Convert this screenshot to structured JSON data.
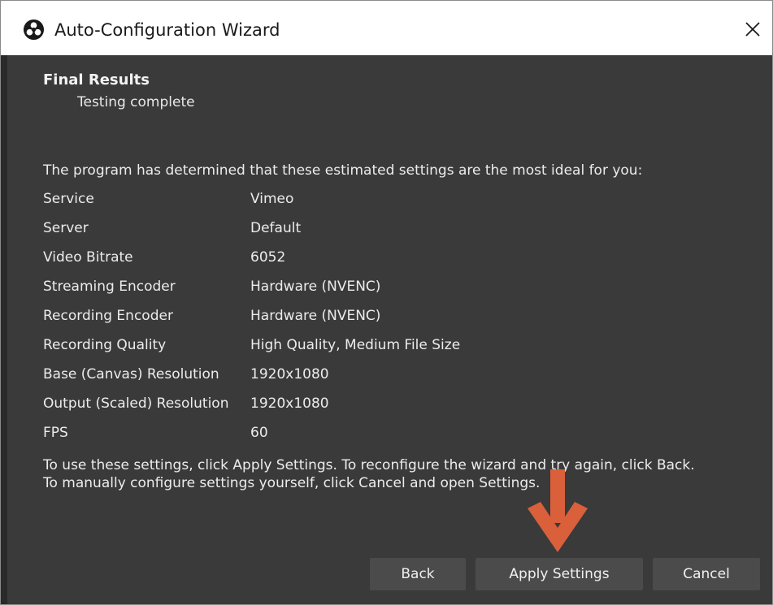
{
  "window": {
    "title": "Auto-Configuration Wizard",
    "close_label": "✕",
    "app_icon": "obs-logo-icon"
  },
  "header": {
    "title": "Final Results",
    "subtitle": "Testing complete"
  },
  "intro": "The program has determined that these estimated settings are the most ideal for you:",
  "settings": [
    {
      "label": "Service",
      "value": "Vimeo"
    },
    {
      "label": "Server",
      "value": "Default"
    },
    {
      "label": "Video Bitrate",
      "value": "6052"
    },
    {
      "label": "Streaming Encoder",
      "value": "Hardware (NVENC)"
    },
    {
      "label": "Recording Encoder",
      "value": "Hardware (NVENC)"
    },
    {
      "label": "Recording Quality",
      "value": "High Quality, Medium File Size"
    },
    {
      "label": "Base (Canvas) Resolution",
      "value": "1920x1080"
    },
    {
      "label": "Output (Scaled) Resolution",
      "value": "1920x1080"
    },
    {
      "label": "FPS",
      "value": "60"
    }
  ],
  "footer": {
    "line1": "To use these settings, click Apply Settings. To reconfigure the wizard and try again, click Back.",
    "line2": "To manually configure settings yourself, click Cancel and open Settings."
  },
  "buttons": {
    "back": "Back",
    "apply": "Apply Settings",
    "cancel": "Cancel"
  },
  "annotation": {
    "arrow_icon": "down-arrow-icon",
    "arrow_color": "#d9603a"
  },
  "colors": {
    "background": "#3a3a3a",
    "button": "#4b4b4b",
    "text": "#ececec"
  }
}
